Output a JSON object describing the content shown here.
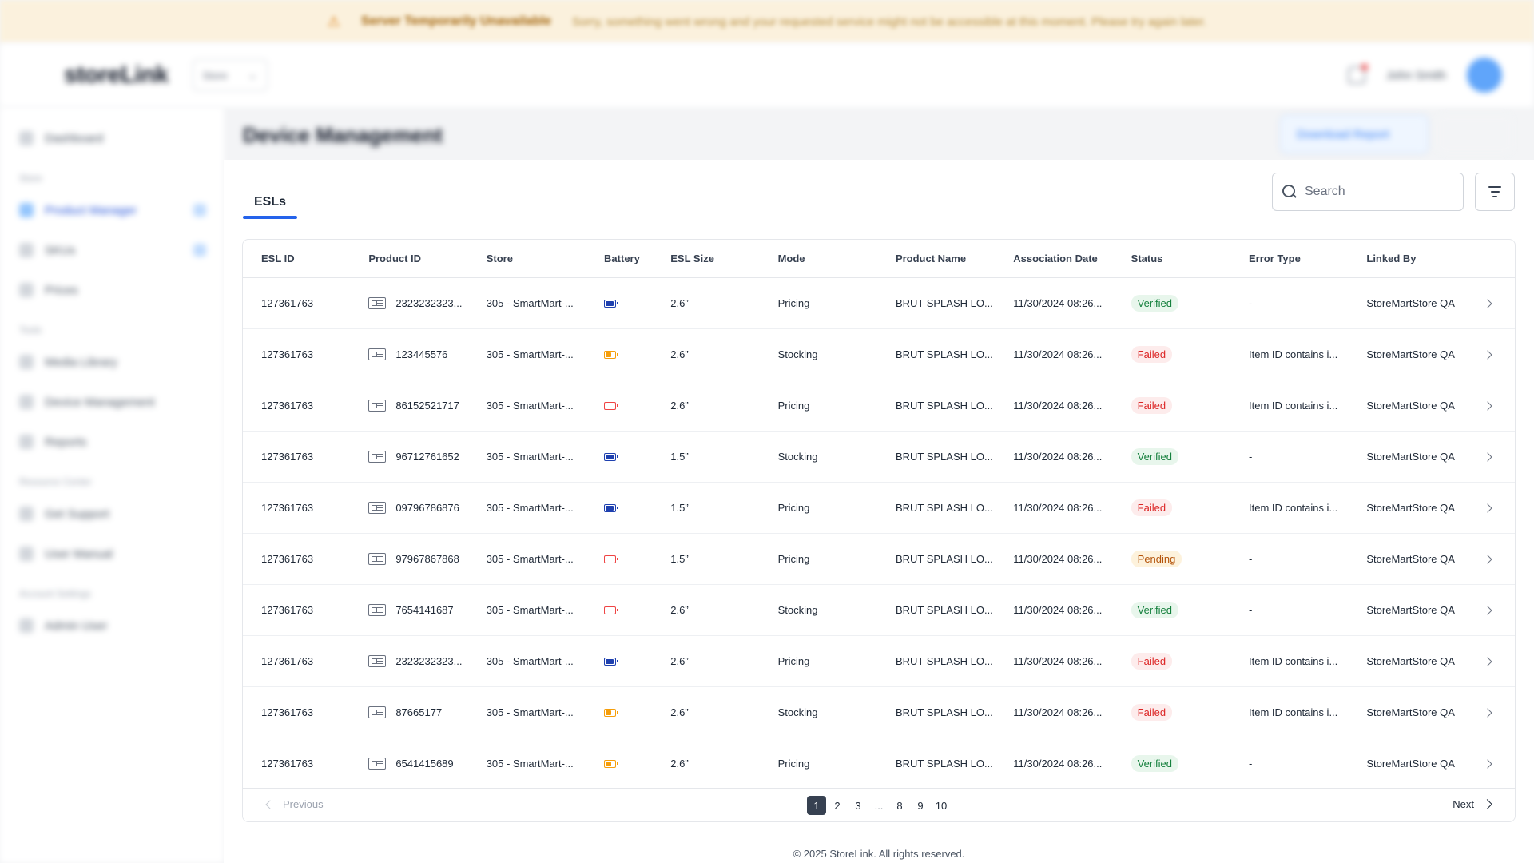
{
  "banner": {
    "title": "Server Temporarily Unavailable",
    "message": "Sorry, something went wrong and your requested service might not be accessible at this moment. Please try again later."
  },
  "app": {
    "logo": "storeLink",
    "store_selector": "Store",
    "user_name": "John Smith"
  },
  "sidebar": {
    "items": [
      {
        "label": "Dashboard",
        "section": ""
      },
      {
        "label": "Product Manager",
        "section": "Store"
      },
      {
        "label": "SKUs",
        "section": ""
      },
      {
        "label": "Prices",
        "section": ""
      },
      {
        "label": "Media Library",
        "section": "Tools"
      },
      {
        "label": "Device Management",
        "section": ""
      },
      {
        "label": "Reports",
        "section": ""
      },
      {
        "label": "Get Support",
        "section": "Resource Center"
      },
      {
        "label": "User Manual",
        "section": ""
      },
      {
        "label": "Admin User",
        "section": "Account Settings"
      }
    ]
  },
  "page": {
    "title": "Device Management",
    "report_button": "Download Report"
  },
  "tabs": [
    {
      "label": "ESLs",
      "active": true
    }
  ],
  "search": {
    "placeholder": "Search",
    "value": ""
  },
  "table": {
    "columns": [
      "ESL ID",
      "Product ID",
      "Store",
      "Battery",
      "ESL Size",
      "Mode",
      "Product Name",
      "Association Date",
      "Status",
      "Error Type",
      "Linked By"
    ],
    "rows": [
      {
        "esl_id": "127361763",
        "product_id": "2323232323...",
        "store": "305 - SmartMart-...",
        "battery": "full",
        "battery_color": "#1e40af",
        "size": "2.6”",
        "mode": "Pricing",
        "product_name": "BRUT SPLASH LO...",
        "date": "11/30/2024 08:26...",
        "status": "Verified",
        "status_key": "verified",
        "error": "-",
        "linked_by": "StoreMartStore QA"
      },
      {
        "esl_id": "127361763",
        "product_id": "123445576",
        "store": "305 - SmartMart-...",
        "battery": "medium",
        "battery_color": "#f59e0b",
        "size": "2.6”",
        "mode": "Stocking",
        "product_name": "BRUT SPLASH LO...",
        "date": "11/30/2024 08:26...",
        "status": "Failed",
        "status_key": "failed",
        "error": "Item ID contains i...",
        "linked_by": "StoreMartStore QA"
      },
      {
        "esl_id": "127361763",
        "product_id": "86152521717",
        "store": "305 - SmartMart-...",
        "battery": "low",
        "battery_color": "#ef4444",
        "size": "2.6”",
        "mode": "Pricing",
        "product_name": "BRUT SPLASH LO...",
        "date": "11/30/2024 08:26...",
        "status": "Failed",
        "status_key": "failed",
        "error": "Item ID contains i...",
        "linked_by": "StoreMartStore QA"
      },
      {
        "esl_id": "127361763",
        "product_id": "96712761652",
        "store": "305 - SmartMart-...",
        "battery": "full",
        "battery_color": "#1e40af",
        "size": "1.5”",
        "mode": "Stocking",
        "product_name": "BRUT SPLASH LO...",
        "date": "11/30/2024 08:26...",
        "status": "Verified",
        "status_key": "verified",
        "error": "-",
        "linked_by": "StoreMartStore QA"
      },
      {
        "esl_id": "127361763",
        "product_id": "09796786876",
        "store": "305 - SmartMart-...",
        "battery": "full",
        "battery_color": "#1e40af",
        "size": "1.5”",
        "mode": "Pricing",
        "product_name": "BRUT SPLASH LO...",
        "date": "11/30/2024 08:26...",
        "status": "Failed",
        "status_key": "failed",
        "error": "Item ID contains i...",
        "linked_by": "StoreMartStore QA"
      },
      {
        "esl_id": "127361763",
        "product_id": "97967867868",
        "store": "305 - SmartMart-...",
        "battery": "low",
        "battery_color": "#ef4444",
        "size": "1.5”",
        "mode": "Pricing",
        "product_name": "BRUT SPLASH LO...",
        "date": "11/30/2024 08:26...",
        "status": "Pending",
        "status_key": "pending",
        "error": "-",
        "linked_by": "StoreMartStore QA"
      },
      {
        "esl_id": "127361763",
        "product_id": "7654141687",
        "store": "305 - SmartMart-...",
        "battery": "low",
        "battery_color": "#ef4444",
        "size": "2.6”",
        "mode": "Stocking",
        "product_name": "BRUT SPLASH LO...",
        "date": "11/30/2024 08:26...",
        "status": "Verified",
        "status_key": "verified",
        "error": "-",
        "linked_by": "StoreMartStore QA"
      },
      {
        "esl_id": "127361763",
        "product_id": "2323232323...",
        "store": "305 - SmartMart-...",
        "battery": "full",
        "battery_color": "#1e40af",
        "size": "2.6”",
        "mode": "Pricing",
        "product_name": "BRUT SPLASH LO...",
        "date": "11/30/2024 08:26...",
        "status": "Failed",
        "status_key": "failed",
        "error": "Item ID contains i...",
        "linked_by": "StoreMartStore QA"
      },
      {
        "esl_id": "127361763",
        "product_id": "87665177",
        "store": "305 - SmartMart-...",
        "battery": "medium",
        "battery_color": "#f59e0b",
        "size": "2.6”",
        "mode": "Stocking",
        "product_name": "BRUT SPLASH LO...",
        "date": "11/30/2024 08:26...",
        "status": "Failed",
        "status_key": "failed",
        "error": "Item ID contains i...",
        "linked_by": "StoreMartStore QA"
      },
      {
        "esl_id": "127361763",
        "product_id": "6541415689",
        "store": "305 - SmartMart-...",
        "battery": "medium",
        "battery_color": "#f59e0b",
        "size": "2.6”",
        "mode": "Pricing",
        "product_name": "BRUT SPLASH LO...",
        "date": "11/30/2024 08:26...",
        "status": "Verified",
        "status_key": "verified",
        "error": "-",
        "linked_by": "StoreMartStore QA"
      }
    ]
  },
  "pagination": {
    "previous": "Previous",
    "next": "Next",
    "pages": [
      "1",
      "2",
      "3",
      "...",
      "8",
      "9",
      "10"
    ],
    "current": "1"
  },
  "footer": {
    "text": "© 2025 StoreLink. All rights reserved."
  },
  "colors": {
    "accent": "#2563eb",
    "verified": "#15803d",
    "failed": "#dc2626",
    "pending": "#b45309"
  }
}
